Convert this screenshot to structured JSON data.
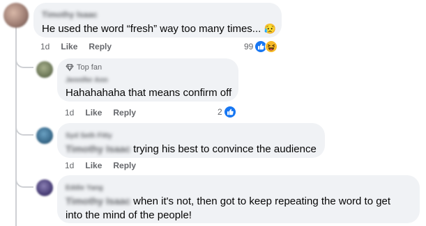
{
  "comments": [
    {
      "author": "Timothy Isaac",
      "text": "He used the word “fresh” way too many times...",
      "emoji": "😥",
      "time": "1d",
      "like": "Like",
      "reply": "Reply",
      "reaction_count": "99",
      "reaction_icons": [
        "like-reaction-icon",
        "haha-reaction-icon"
      ]
    },
    {
      "badge": "Top fan",
      "author": "Jennifer Ann",
      "text": "Hahahahaha that means confirm off",
      "time": "1d",
      "like": "Like",
      "reply": "Reply",
      "reaction_count": "2",
      "reaction_icons": [
        "like-reaction-icon"
      ]
    },
    {
      "author": "Syd Seth Fitty",
      "mention": "Timothy Isaac",
      "text": "trying his best to convince the audience",
      "time": "1d",
      "like": "Like",
      "reply": "Reply"
    },
    {
      "author": "Eddie Yang",
      "mention": "Timothy Isaac",
      "text_line1": "when it's not, then got to keep repeating the word to get",
      "text_line2": "into the mind of the people!"
    }
  ],
  "colors": {
    "bubble": "#f0f2f5",
    "meta_text": "#65676b",
    "like_blue": "#1877f2",
    "thread_line": "#ced0d4"
  }
}
